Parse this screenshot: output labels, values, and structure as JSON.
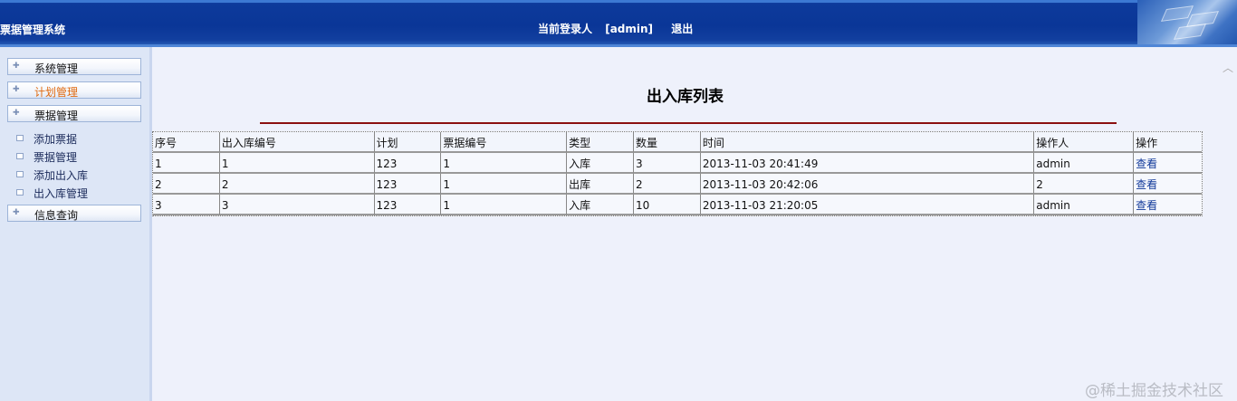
{
  "header": {
    "app_title": "票据管理系统",
    "login_label": "当前登录人",
    "username": "[admin]",
    "logout": "退出"
  },
  "sidebar": {
    "menus": [
      {
        "label": "系统管理"
      },
      {
        "label": "计划管理",
        "active": true
      },
      {
        "label": "票据管理"
      },
      {
        "label": "信息查询"
      }
    ],
    "submenu": [
      {
        "label": "添加票据"
      },
      {
        "label": "票据管理"
      },
      {
        "label": "添加出入库"
      },
      {
        "label": "出入库管理"
      }
    ]
  },
  "main": {
    "title": "出入库列表",
    "table": {
      "headers": [
        "序号",
        "出入库编号",
        "计划",
        "票据编号",
        "类型",
        "数量",
        "时间",
        "操作人",
        "操作"
      ],
      "rows": [
        [
          "1",
          "1",
          "123",
          "1",
          "入库",
          "3",
          "2013-11-03 20:41:49",
          "admin",
          "查看"
        ],
        [
          "2",
          "2",
          "123",
          "1",
          "出库",
          "2",
          "2013-11-03 20:42:06",
          "2",
          "查看"
        ],
        [
          "3",
          "3",
          "123",
          "1",
          "入库",
          "10",
          "2013-11-03 21:20:05",
          "admin",
          "查看"
        ]
      ]
    }
  },
  "watermark": "@稀土掘金技术社区",
  "colors": {
    "header_blue": "#0a3697",
    "active_menu": "#e06a10",
    "title_rule": "#8b1010",
    "link": "#123a9a"
  },
  "icons": [
    "plus-icon",
    "submenu-box-icon",
    "scroll-up-icon"
  ]
}
